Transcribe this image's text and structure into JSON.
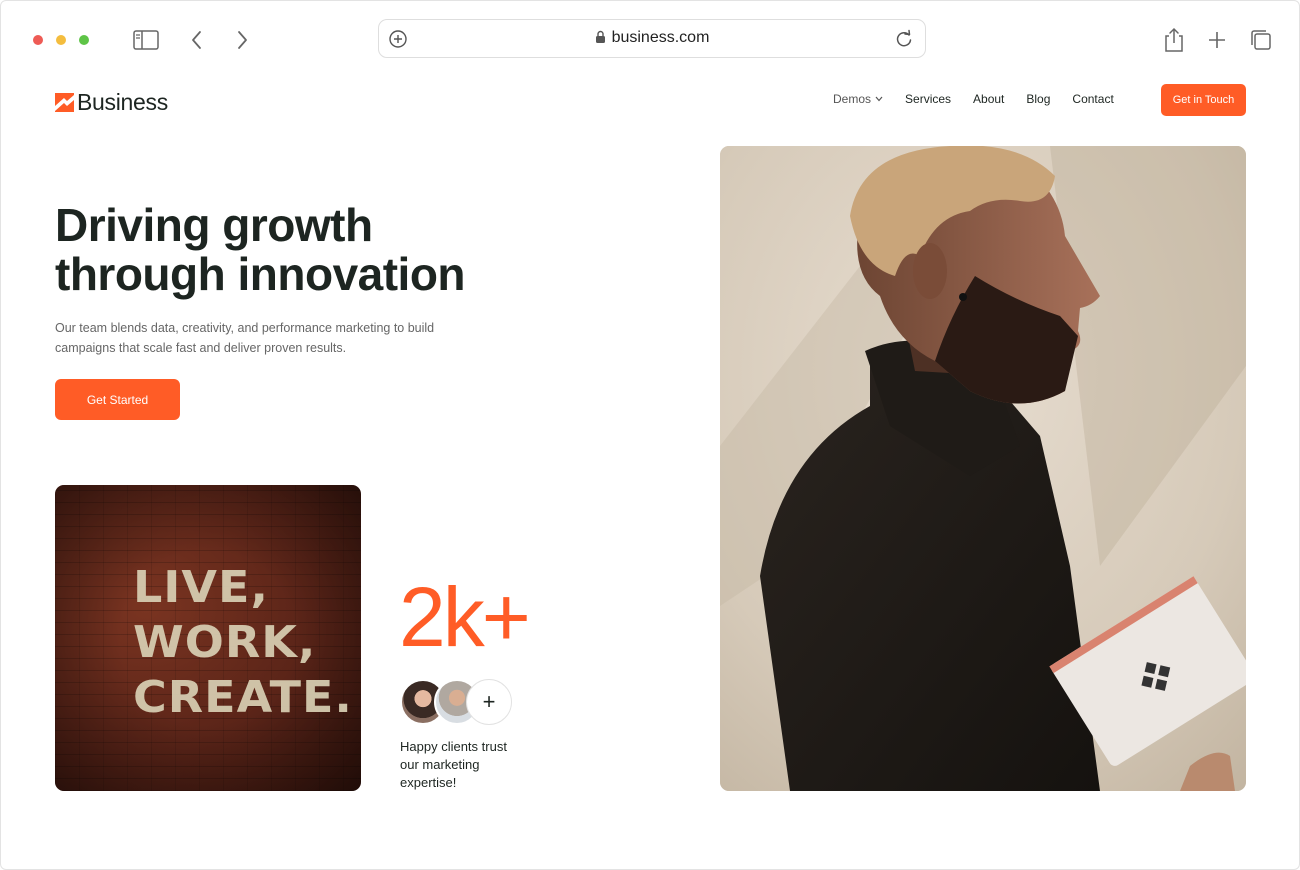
{
  "browser": {
    "url": "business.com",
    "icons": [
      "sidebar-icon",
      "back-icon",
      "forward-icon",
      "add-tab-icon",
      "lock-icon",
      "reload-icon",
      "share-icon",
      "new-tab-icon",
      "tabs-overview-icon"
    ]
  },
  "site": {
    "logo_text": "Business",
    "brand_color": "#ff5c26",
    "nav": {
      "demos": "Demos",
      "services": "Services",
      "about": "About",
      "blog": "Blog",
      "contact": "Contact"
    },
    "cta_top": "Get in Touch"
  },
  "hero": {
    "title_line1": "Driving growth",
    "title_line2": "through innovation",
    "subtitle_line1": "Our team blends data, creativity, and performance marketing to build",
    "subtitle_line2": "campaigns that scale fast and deliver proven results.",
    "cta": "Get Started"
  },
  "feature_image": {
    "line1": "LIVE,",
    "line2": "WORK,",
    "line3": "CREATE."
  },
  "stats": {
    "number": "2k+",
    "avatar_more": "+",
    "caption_line1": "Happy clients trust",
    "caption_line2": "our marketing",
    "caption_line3": "expertise!"
  }
}
